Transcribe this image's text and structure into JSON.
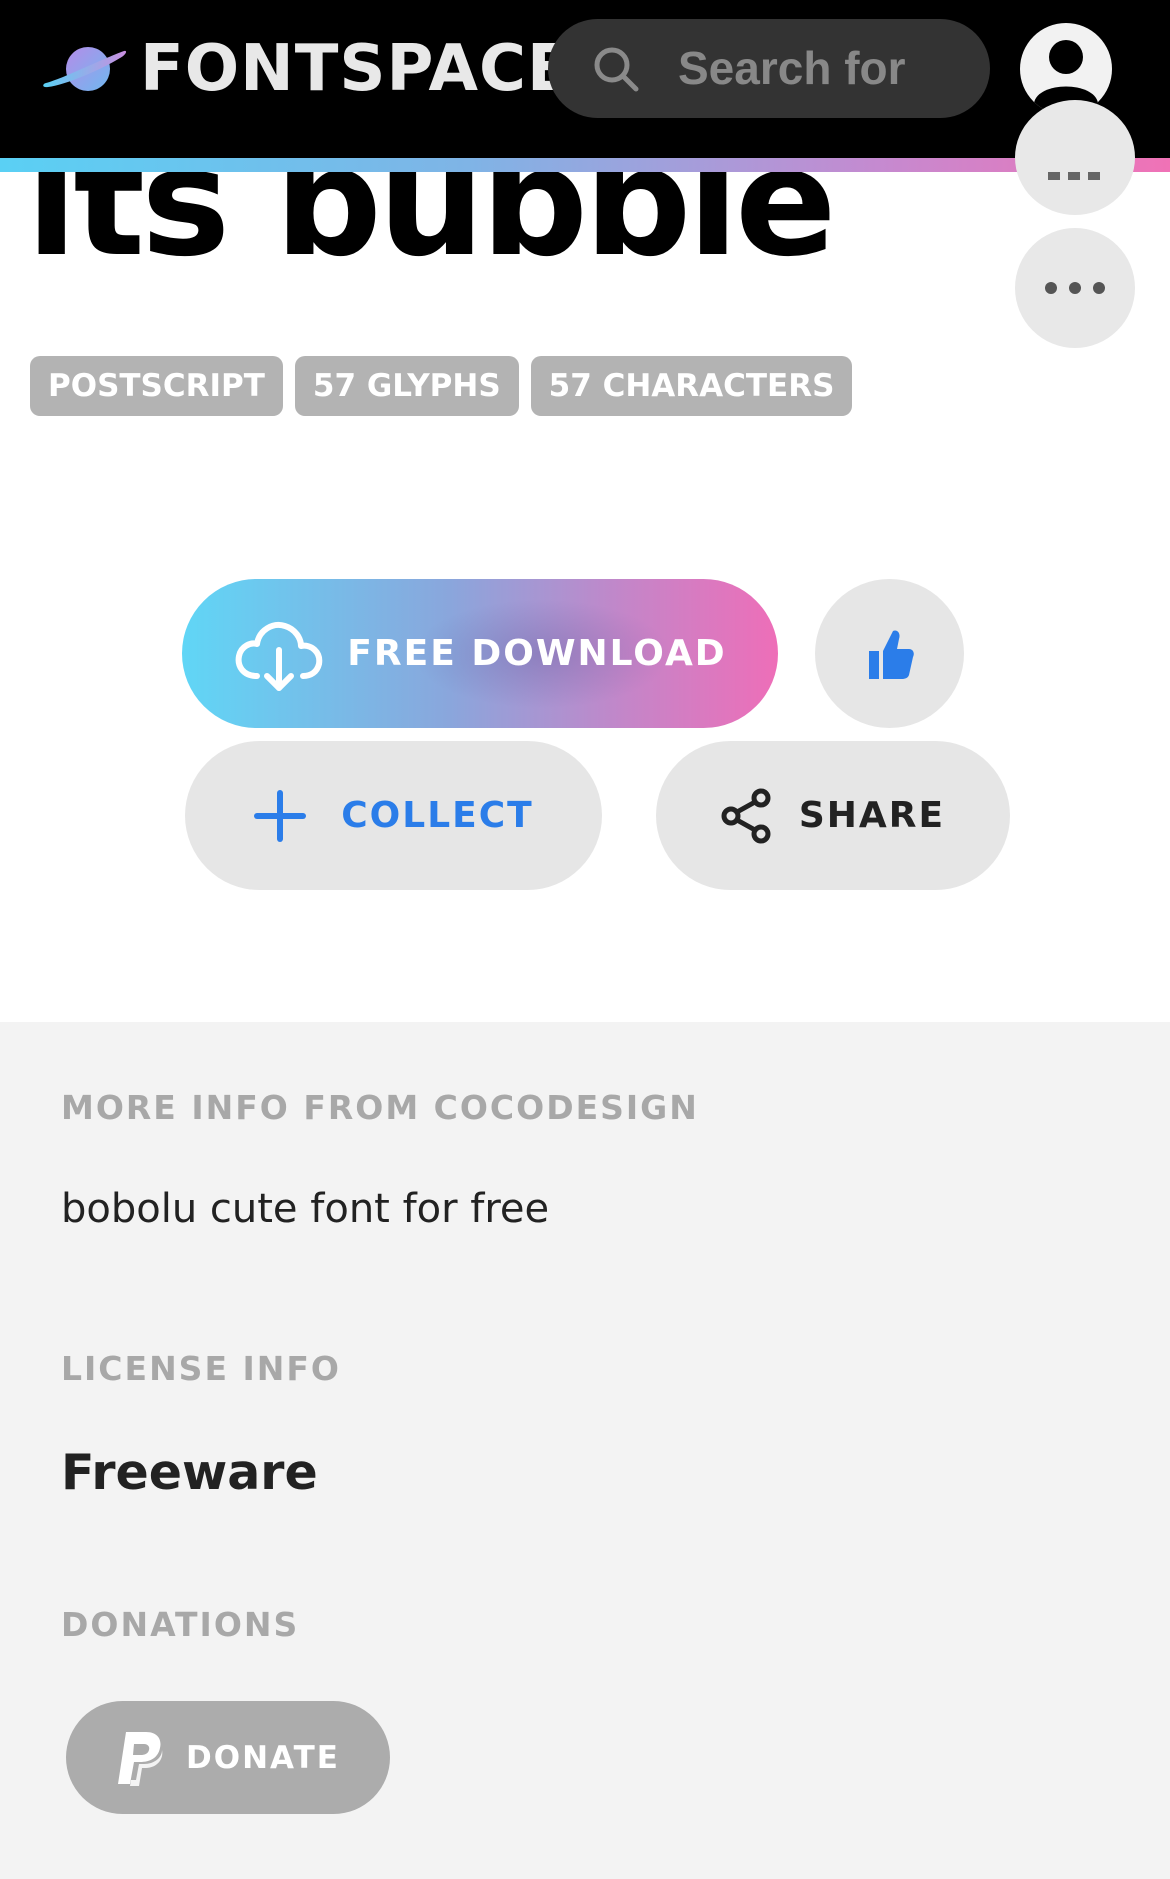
{
  "header": {
    "logo_text": "FONTSPACE",
    "search_placeholder": "Search for"
  },
  "preview": {
    "sample_text": "its bubble"
  },
  "badges": [
    "POSTSCRIPT",
    "57 GLYPHS",
    "57 CHARACTERS"
  ],
  "actions": {
    "download_label": "FREE DOWNLOAD",
    "collect_label": "COLLECT",
    "share_label": "SHARE"
  },
  "info": {
    "more_info_label": "MORE INFO FROM COCODESIGN",
    "description": "bobolu cute font for free",
    "license_label": "LICENSE INFO",
    "license_value": "Freeware",
    "donations_label": "DONATIONS",
    "donate_label": "DONATE"
  },
  "colors": {
    "header_bg": "#000000",
    "accent_blue": "#2b7de9",
    "gradient_start": "#60d6f6",
    "gradient_end": "#ee6eb8",
    "badge_bg": "#b3b3b3"
  },
  "icons": [
    "planet-logo-icon",
    "search-icon",
    "avatar-icon",
    "more-icon",
    "cloud-download-icon",
    "thumbs-up-icon",
    "plus-icon",
    "share-icon",
    "paypal-icon"
  ]
}
